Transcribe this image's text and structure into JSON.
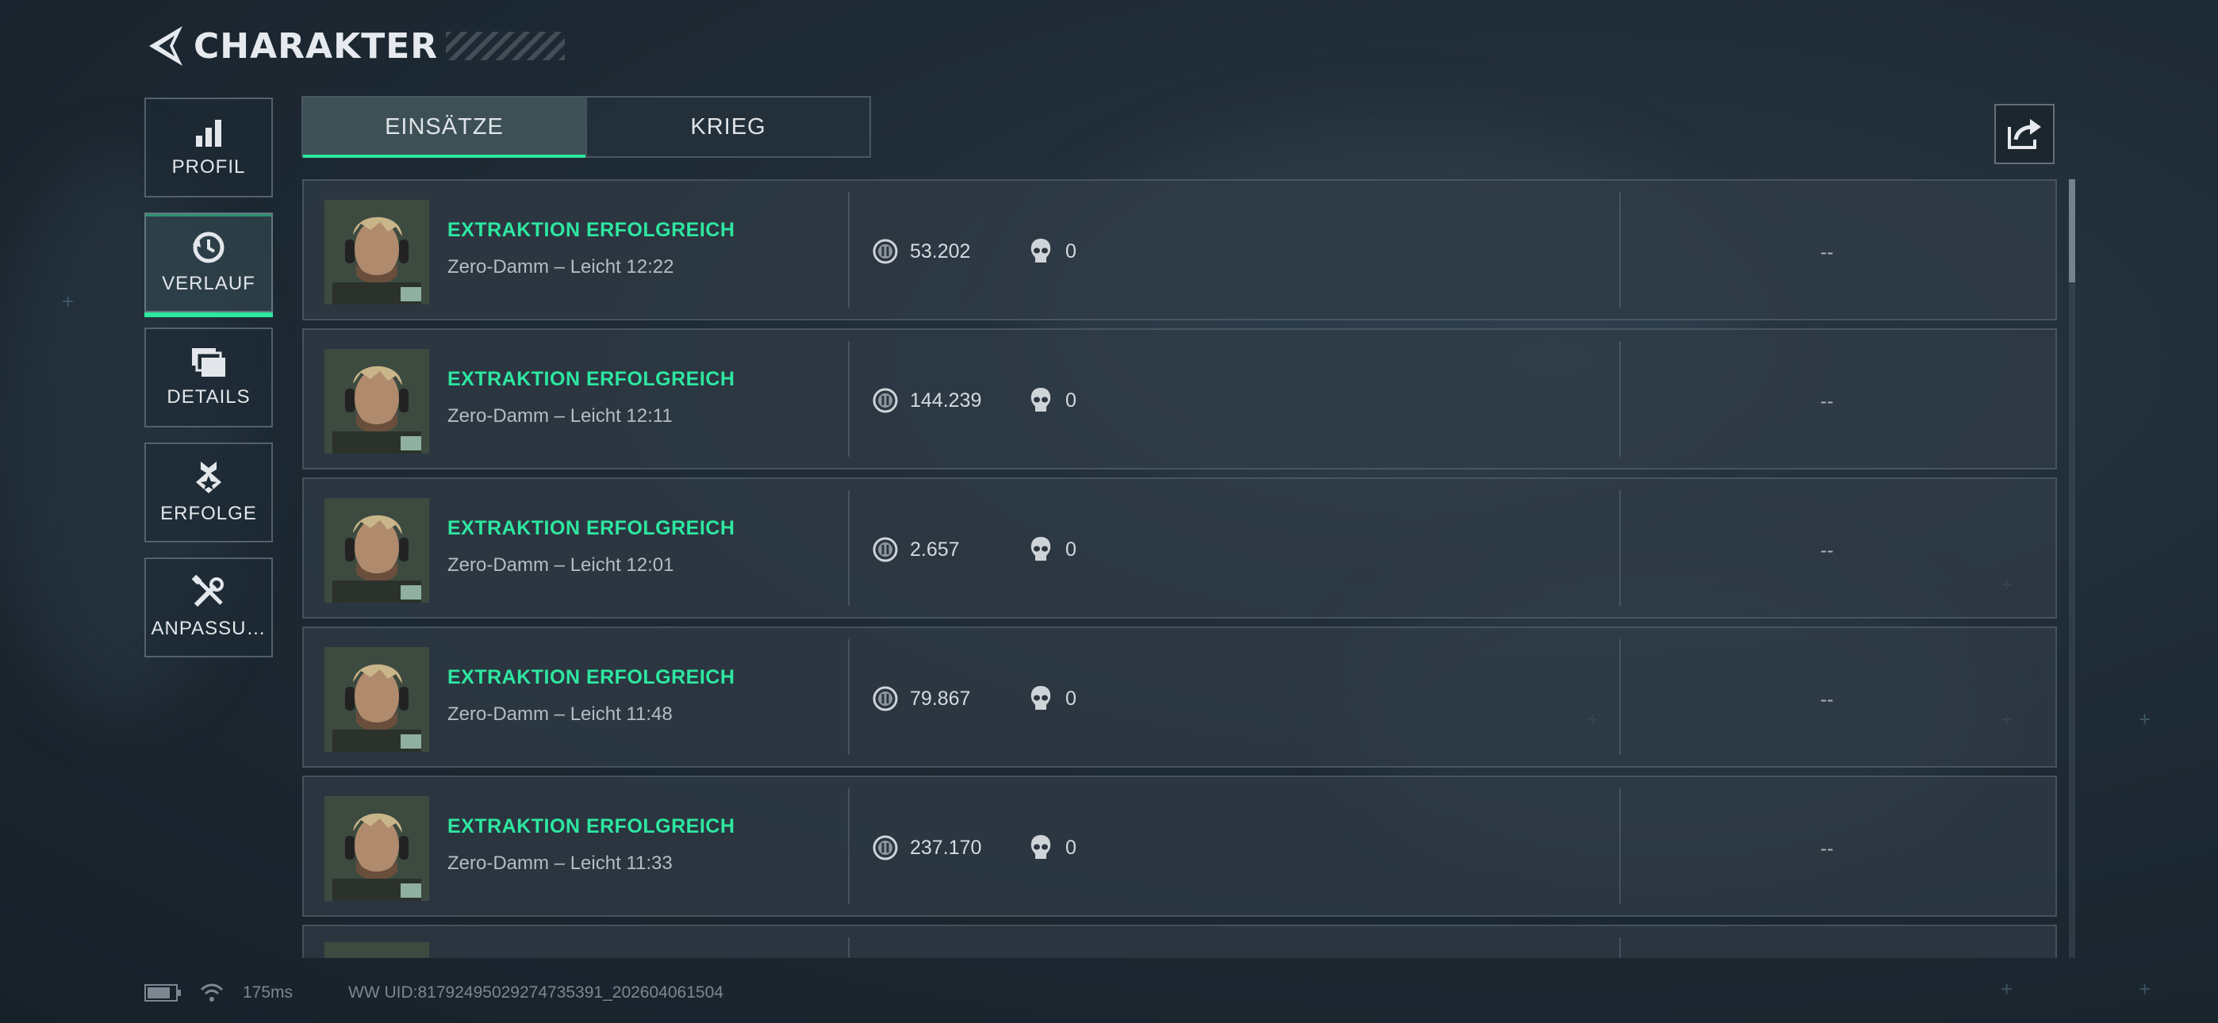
{
  "header": {
    "title": "CHARAKTER"
  },
  "sidebar": {
    "items": [
      {
        "label": "PROFIL",
        "icon": "bar-chart-icon"
      },
      {
        "label": "VERLAUF",
        "icon": "history-clock-icon",
        "active": true
      },
      {
        "label": "DETAILS",
        "icon": "folders-icon"
      },
      {
        "label": "ERFOLGE",
        "icon": "medal-icon"
      },
      {
        "label": "ANPASSU…",
        "icon": "tools-icon"
      }
    ]
  },
  "tabs": [
    {
      "label": "EINSÄTZE",
      "active": true
    },
    {
      "label": "KRIEG"
    }
  ],
  "share": {
    "icon": "share-icon"
  },
  "matches": [
    {
      "status": "EXTRAKTION ERFOLGREICH",
      "desc": "Zero-Damm – Leicht 12:22",
      "credits": "53.202",
      "kills": "0",
      "extra": "--"
    },
    {
      "status": "EXTRAKTION ERFOLGREICH",
      "desc": "Zero-Damm – Leicht 12:11",
      "credits": "144.239",
      "kills": "0",
      "extra": "--"
    },
    {
      "status": "EXTRAKTION ERFOLGREICH",
      "desc": "Zero-Damm – Leicht 12:01",
      "credits": "2.657",
      "kills": "0",
      "extra": "--"
    },
    {
      "status": "EXTRAKTION ERFOLGREICH",
      "desc": "Zero-Damm – Leicht 11:48",
      "credits": "79.867",
      "kills": "0",
      "extra": "--"
    },
    {
      "status": "EXTRAKTION ERFOLGREICH",
      "desc": "Zero-Damm – Leicht 11:33",
      "credits": "237.170",
      "kills": "0",
      "extra": "--"
    }
  ],
  "colors": {
    "accent": "#2ee7a0",
    "background": "#1f2b35"
  },
  "footer": {
    "ping": "175ms",
    "uid": "WW UID:8179249502927473539​1_202604061504"
  }
}
